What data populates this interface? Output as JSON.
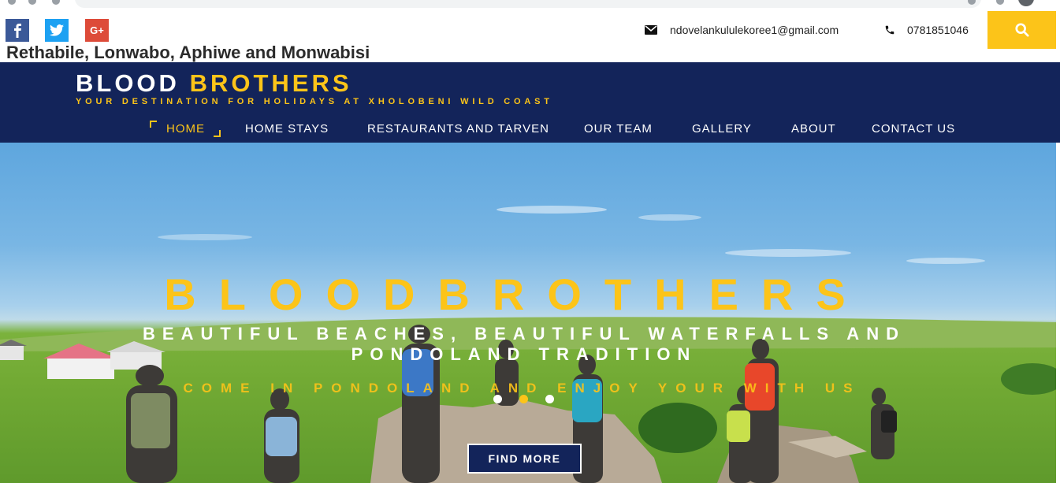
{
  "social": {
    "facebook_icon": "facebook-icon",
    "twitter_icon": "twitter-icon",
    "googleplus_icon": "google-plus-icon",
    "googleplus_label": "G+"
  },
  "owners": "Rethabile, Lonwabo, Aphiwe and Monwabisi",
  "contact": {
    "email": "ndovelankululekoree1@gmail.com",
    "phone": "0781851046"
  },
  "brand": {
    "part1": "BLOOD",
    "part2": "BROTHERS",
    "tagline": "YOUR DESTINATION FOR HOLIDAYS AT XHOLOBENI WILD COAST"
  },
  "nav": {
    "items": [
      {
        "label": "HOME"
      },
      {
        "label": "HOME STAYS"
      },
      {
        "label": "RESTAURANTS AND TARVEN"
      },
      {
        "label": "OUR TEAM"
      },
      {
        "label": "GALLERY"
      },
      {
        "label": "ABOUT"
      },
      {
        "label": "CONTACT US"
      }
    ],
    "active_index": 0
  },
  "hero": {
    "title": "BLOODBROTHERS",
    "subtitle": "BEAUTIFUL BEACHES, BEAUTIFUL WATERFALLS AND PONDOLAND TRADITION",
    "tagline": "COME IN PONDOLAND AND ENJOY YOUR WITH US",
    "slides": 3,
    "active_slide": 1,
    "button_label": "FIND MORE"
  },
  "colors": {
    "navy": "#13245a",
    "accent": "#fcc419",
    "facebook": "#3b5998",
    "twitter": "#1da1f2",
    "googleplus": "#dd4b39"
  }
}
